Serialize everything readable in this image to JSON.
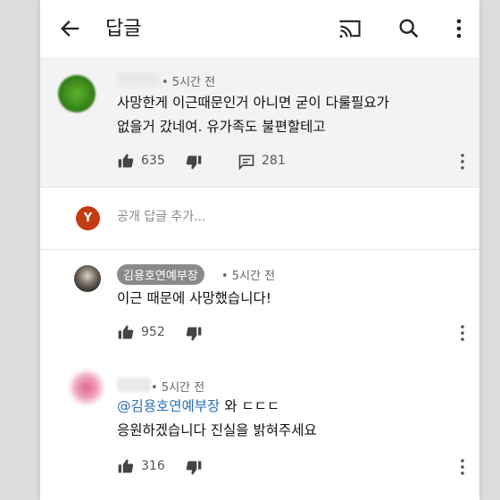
{
  "header": {
    "title": "답글"
  },
  "parent_comment": {
    "time": "• 5시간 전",
    "text_line1": "사망한게 이근때문인거 아니면 굳이 다룰필요가",
    "text_line2": "없을거 갔네여. 유가족도 불편할테고",
    "likes": "635",
    "replies": "281"
  },
  "add_reply": {
    "avatar_letter": "Y",
    "placeholder": "공개 답글 추가..."
  },
  "replies": [
    {
      "author": "김용호연예부장",
      "time": "• 5시간 전",
      "text": "이근 때문에 사망했습니다!",
      "likes": "952"
    },
    {
      "time": "• 5시간 전",
      "mention": "@김용호연예부장",
      "text_after_mention": " 와 ㄷㄷㄷ",
      "text_line2": "응원하겠습니다 진실을 밝혀주세요",
      "likes": "316"
    }
  ],
  "colors": {
    "avatar_green": "#3d8a1f",
    "avatar_red": "#c13d14",
    "mention_blue": "#2a6fb8",
    "avatar_pink": "#e0628a"
  }
}
